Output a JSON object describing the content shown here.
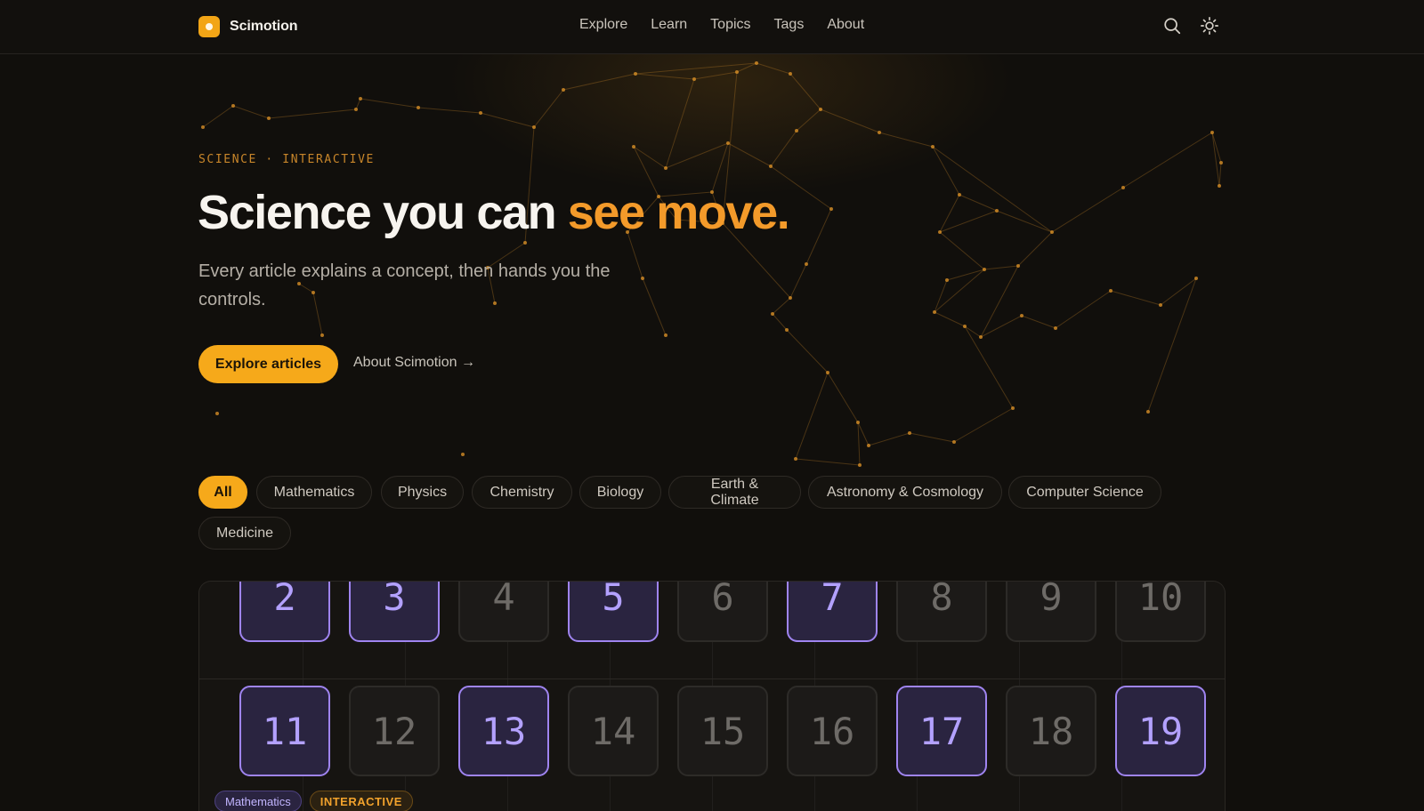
{
  "brand": {
    "name": "Scimotion",
    "accent": "#f2a516"
  },
  "nav": {
    "items": [
      "Explore",
      "Learn",
      "Topics",
      "Tags",
      "About"
    ]
  },
  "toolbar": {
    "search_icon": "search-icon",
    "theme_icon": "sun-icon"
  },
  "hero": {
    "eyebrow": "SCIENCE · INTERACTIVE",
    "headline_start": "Science you can ",
    "headline_accent": "see move.",
    "lede": "Every article explains a concept, then hands you the controls.",
    "primary_cta": "Explore articles",
    "secondary_link": "About Scimotion →"
  },
  "filters": {
    "selected": "All",
    "items": [
      "All",
      "Mathematics",
      "Physics",
      "Chemistry",
      "Biology",
      "Earth & Climate",
      "Astronomy & Cosmology",
      "Computer Science",
      "Medicine"
    ]
  },
  "article_preview": {
    "row_1": [
      {
        "n": "2",
        "highlight": true
      },
      {
        "n": "3",
        "highlight": true
      },
      {
        "n": "4",
        "highlight": false
      },
      {
        "n": "5",
        "highlight": true
      },
      {
        "n": "6",
        "highlight": false
      },
      {
        "n": "7",
        "highlight": true
      },
      {
        "n": "8",
        "highlight": false
      },
      {
        "n": "9",
        "highlight": false
      },
      {
        "n": "10",
        "highlight": false
      }
    ],
    "row_2": [
      {
        "n": "11",
        "highlight": true
      },
      {
        "n": "12",
        "highlight": false
      },
      {
        "n": "13",
        "highlight": true
      },
      {
        "n": "14",
        "highlight": false
      },
      {
        "n": "15",
        "highlight": false
      },
      {
        "n": "16",
        "highlight": false
      },
      {
        "n": "17",
        "highlight": true
      },
      {
        "n": "18",
        "highlight": false
      },
      {
        "n": "19",
        "highlight": true
      }
    ],
    "tags": [
      "Mathematics",
      "INTERACTIVE"
    ]
  },
  "colors": {
    "accent": "#f6a91a",
    "headline_accent": "#f39a2a",
    "highlight": "#9f84f0",
    "background": "#110f0c"
  }
}
